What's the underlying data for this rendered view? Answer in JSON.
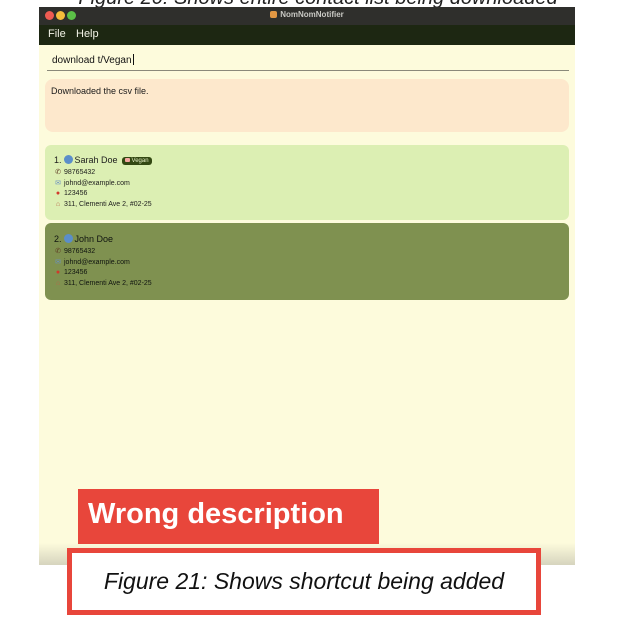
{
  "caption_top": "Figure 20: Shows entire contact list being downloaded",
  "window": {
    "title": "NomNomNotifier",
    "menu": [
      "File",
      "Help"
    ]
  },
  "command": {
    "value": "download t/Vegan"
  },
  "result": {
    "message": "Downloaded the csv file."
  },
  "contacts": [
    {
      "index": "1.",
      "name": "Sarah Doe",
      "tag": "Vegan",
      "phone": "98765432",
      "email": "johnd@example.com",
      "postal": "123456",
      "address": "311, Clementi Ave 2, #02-25"
    },
    {
      "index": "2.",
      "name": "John Doe",
      "phone": "98765432",
      "email": "johnd@example.com",
      "postal": "123456",
      "address": "311, Clementi Ave 2, #02-25"
    }
  ],
  "annotation": {
    "label": "Wrong description"
  },
  "caption_bottom": "Figure 21: Shows shortcut being added",
  "colors": {
    "accent_red": "#e8463b",
    "menubar": "#1d2712",
    "card_light": "#dcefb3",
    "card_dark": "#7f9150",
    "result_bg": "#fde8cc"
  }
}
